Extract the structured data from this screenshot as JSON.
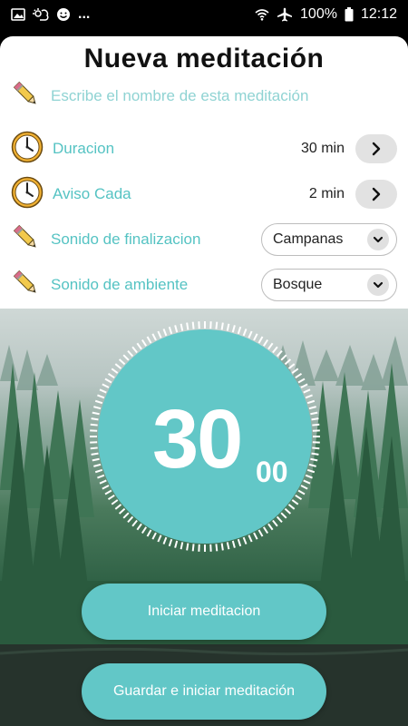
{
  "status_bar": {
    "left_more": "...",
    "battery": "100%",
    "time": "12:12"
  },
  "header": {
    "title": "Nueva meditación"
  },
  "name_field": {
    "placeholder": "Escribe el nombre de esta meditación",
    "value": ""
  },
  "rows": {
    "duration": {
      "label": "Duracion",
      "value": "30 min"
    },
    "interval": {
      "label": "Aviso Cada",
      "value": "2 min"
    },
    "end_sound": {
      "label": "Sonido de finalizacion",
      "selected": "Campanas"
    },
    "ambient_sound": {
      "label": "Sonido de ambiente",
      "selected": "Bosque"
    }
  },
  "timer": {
    "minutes": "30",
    "seconds": "00"
  },
  "buttons": {
    "start": "Iniciar meditacion",
    "save_start": "Guardar e iniciar meditación"
  },
  "colors": {
    "accent": "#62c7c7",
    "label": "#55c3c3"
  }
}
